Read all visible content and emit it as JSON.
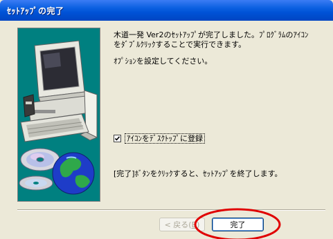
{
  "window": {
    "title": "ｾｯﾄｱｯﾌﾟの完了"
  },
  "content": {
    "message_line1": "木道一発 Ver2のｾｯﾄｱｯﾌﾟが完了しました。ﾌﾟﾛｸﾞﾗﾑのｱｲｺﾝ",
    "message_line2": "をﾀﾞﾌﾞﾙｸﾘｯｸすることで実行できます。",
    "options_prompt": "ｵﾌﾟｼｮﾝを設定してください。",
    "checkbox_label": "ｱｲｺﾝをﾃﾞｽｸﾄｯﾌﾟに登録",
    "checkbox_checked": true,
    "finish_hint": "[完了]ﾎﾞﾀﾝをｸﾘｯｸすると、ｾｯﾄｱｯﾌﾟを終了します。"
  },
  "buttons": {
    "back_label": "< 戻る(",
    "back_mnemonic": "B",
    "back_suffix": ")",
    "back_enabled": false,
    "finish_label": "完了"
  },
  "colors": {
    "titlebar": "#0a5fe0",
    "panel_bg": "#008080",
    "dialog_bg": "#ece9d8",
    "annotation": "#e00000"
  },
  "icons": {
    "illustration": "computer-with-cds-and-globe-illustration"
  }
}
